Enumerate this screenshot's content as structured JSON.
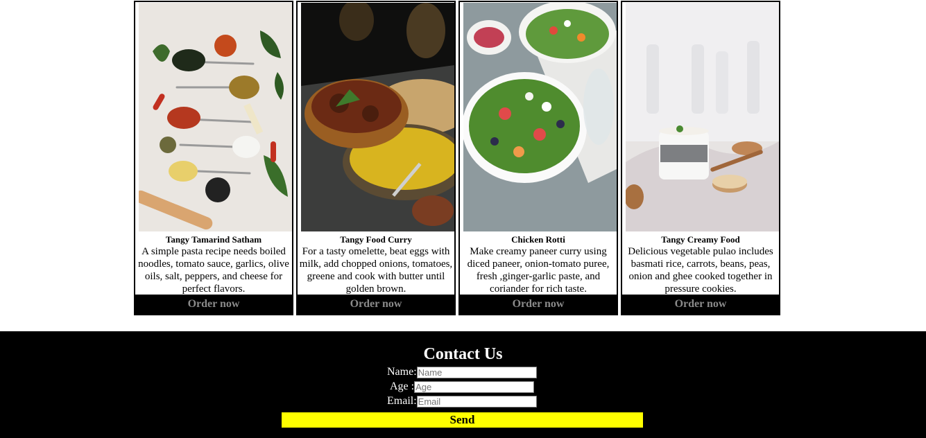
{
  "cards": [
    {
      "title": "Tangy Tamarind Satham",
      "description": "A simple pasta recipe needs boiled noodles, tomato sauce, garlics, olive oils, salt, peppers, and cheese for perfect flavors.",
      "button": "Order now",
      "photo": "spices-on-spoons"
    },
    {
      "title": "Tangy Food Curry",
      "description": "For a tasty omelette, beat eggs with milk, add chopped onions, tomatoes, greene and cook with butter until golden brown.",
      "button": "Order now",
      "photo": "curry-with-rice"
    },
    {
      "title": "Chicken Rotti",
      "description": "Make creamy paneer curry using diced paneer, onion-tomato puree, fresh ,ginger-garlic paste, and coriander for rich taste.",
      "button": "Order now",
      "photo": "salad-bowls"
    },
    {
      "title": "Tangy Creamy Food",
      "description": "Delicious vegetable pulao includes basmati rice, carrots, beans, peas, onion and ghee cooked together in pressure cookies.",
      "button": "Order now",
      "photo": "chia-pudding"
    }
  ],
  "contact": {
    "heading": "Contact Us",
    "name_label": "Name:",
    "name_placeholder": "Name",
    "name_value": "",
    "age_label": "Age :",
    "age_placeholder": "Age",
    "age_value": "",
    "email_label": "Email:",
    "email_placeholder": "Email",
    "email_value": "",
    "send_label": "Send"
  },
  "colors": {
    "footer_background": "#000000",
    "send_button": "#ffff00",
    "order_button_text": "#8a8a8a"
  }
}
